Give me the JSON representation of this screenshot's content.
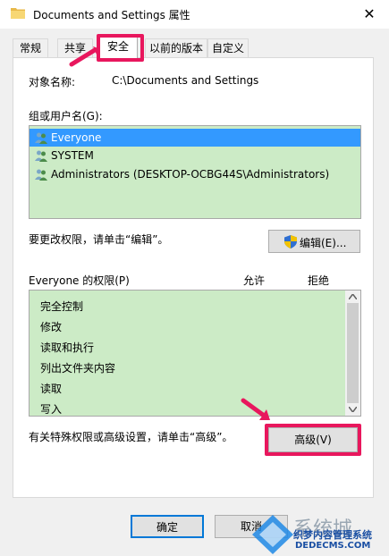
{
  "window": {
    "title": "Documents and Settings 属性",
    "close_glyph": "✕"
  },
  "tabs": [
    {
      "label": "常规",
      "active": false
    },
    {
      "label": "共享",
      "active": false
    },
    {
      "label": "安全",
      "active": true
    },
    {
      "label": "以前的版本",
      "active": false
    },
    {
      "label": "自定义",
      "active": false
    }
  ],
  "security": {
    "object_name_label": "对象名称:",
    "object_name_value": "C:\\Documents and Settings",
    "groups_label": "组或用户名(G):",
    "groups": [
      {
        "name": "Everyone",
        "selected": true
      },
      {
        "name": "SYSTEM",
        "selected": false
      },
      {
        "name": "Administrators (DESKTOP-OCBG44S\\Administrators)",
        "selected": false
      }
    ],
    "edit_hint": "要更改权限，请单击“编辑”。",
    "edit_button": "编辑(E)...",
    "permissions_label": "Everyone 的权限(P)",
    "allow_header": "允许",
    "deny_header": "拒绝",
    "permissions": [
      "完全控制",
      "修改",
      "读取和执行",
      "列出文件夹内容",
      "读取",
      "写入"
    ],
    "advanced_hint": "有关特殊权限或高级设置，请单击“高级”。",
    "advanced_button": "高级(V)"
  },
  "footer": {
    "ok_button": "确定",
    "cancel_button": "取消"
  },
  "watermark": {
    "brand": "系统城",
    "line1": "织梦内容管理系统",
    "line2": "DEDECMS.COM"
  },
  "colors": {
    "highlight": "#e8175d",
    "list_bg": "#ccebc6",
    "selection": "#3399ff"
  }
}
